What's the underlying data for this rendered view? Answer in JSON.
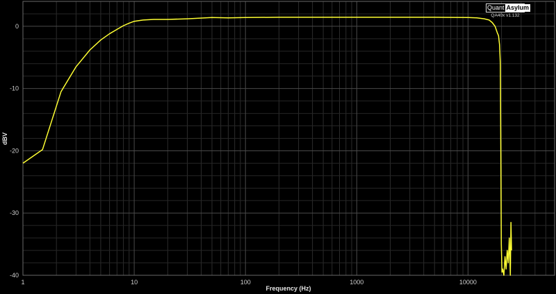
{
  "chart_data": {
    "type": "line",
    "xlabel": "Frequency (Hz)",
    "ylabel": "dBV",
    "xscale": "log",
    "xlim": [
      1,
      60000
    ],
    "ylim": [
      -40,
      4
    ],
    "x_ticks": [
      1,
      10,
      100,
      1000,
      10000
    ],
    "x_tick_labels": [
      "1",
      "10",
      "100",
      "1000",
      "10000"
    ],
    "y_ticks": [
      0,
      -10,
      -20,
      -30,
      -40
    ],
    "y_tick_labels": [
      "0",
      "-10",
      "-20",
      "-30",
      "-40"
    ],
    "grid": true,
    "colors": {
      "background": "#000000",
      "grid": "#4a4a4a",
      "series": "#ffff33"
    },
    "series": [
      {
        "x": [
          1,
          1.5,
          2.2,
          3,
          4,
          5,
          6,
          7,
          8,
          9,
          10,
          12,
          15,
          20,
          30,
          50,
          70,
          100,
          200,
          500,
          1000,
          2000,
          5000,
          10000,
          12000,
          14000,
          15500,
          16500,
          17500,
          18300,
          18800,
          19200,
          19500,
          19700,
          19900,
          20200,
          20500,
          21000,
          21500,
          22000,
          22500,
          23000,
          23500,
          24000,
          24300,
          24600
        ],
        "y": [
          -22,
          -19.8,
          -10.5,
          -6.5,
          -3.8,
          -2.2,
          -1.2,
          -0.5,
          0.1,
          0.5,
          0.8,
          1.0,
          1.1,
          1.1,
          1.2,
          1.4,
          1.35,
          1.4,
          1.45,
          1.45,
          1.45,
          1.45,
          1.45,
          1.4,
          1.35,
          1.2,
          1.0,
          0.6,
          0.0,
          -1.0,
          -1.5,
          -3,
          -6,
          -20,
          -35,
          -39.5,
          -39,
          -40,
          -37,
          -39,
          -36,
          -38,
          -34,
          -40,
          -31.5,
          -36
        ]
      }
    ]
  },
  "logo": {
    "brand_left": "Quant",
    "brand_right": "Asylum",
    "version": "QA40x v1.132"
  }
}
